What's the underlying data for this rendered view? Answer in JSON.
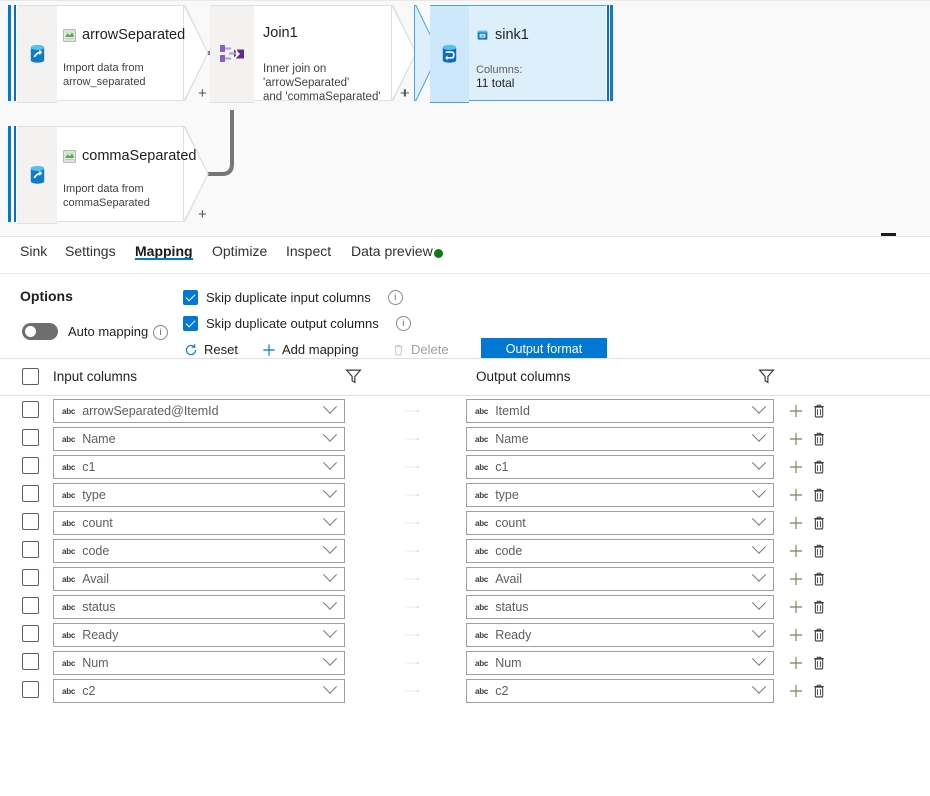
{
  "canvas": {
    "nodes": [
      {
        "id": "arrowSeparated",
        "title": "arrowSeparated",
        "subtitle": "Import data from\narrow_separated",
        "icon": "dataset-file-icon",
        "source_icon": "source-database-icon",
        "plus": "+"
      },
      {
        "id": "commaSeparated",
        "title": "commaSeparated",
        "subtitle": "Import data from\ncommaSeparated",
        "icon": "dataset-file-icon",
        "source_icon": "source-database-icon",
        "plus": "+"
      },
      {
        "id": "Join1",
        "title": "Join1",
        "subtitle": "Inner join on 'arrowSeparated'\nand 'commaSeparated'",
        "icon": "join-icon",
        "plus": "+"
      },
      {
        "id": "sink1",
        "title": "sink1",
        "subtitle_label": "Columns:",
        "subtitle_value": "11 total",
        "icon": "sink-dataset-icon",
        "sink_icon": "sink-database-icon",
        "selected": true
      }
    ],
    "minimize_label": "minimize-panel"
  },
  "tabs": {
    "items": [
      {
        "label": "Sink",
        "active": false
      },
      {
        "label": "Settings",
        "active": false
      },
      {
        "label": "Mapping",
        "active": true
      },
      {
        "label": "Optimize",
        "active": false
      },
      {
        "label": "Inspect",
        "active": false
      },
      {
        "label": "Data preview",
        "active": false,
        "status_dot": "#107c10"
      }
    ],
    "active_underline_color": "#0078d4"
  },
  "options": {
    "section_label": "Options",
    "checkboxes": [
      {
        "label": "Skip duplicate input columns",
        "checked": true,
        "info": "ⓘ"
      },
      {
        "label": "Skip duplicate output columns",
        "checked": true,
        "info": "ⓘ"
      }
    ],
    "auto_mapping": {
      "label": "Auto mapping",
      "on": false,
      "info": "ⓘ"
    },
    "commands": [
      {
        "label": "Reset",
        "icon": "refresh-icon",
        "disabled": false
      },
      {
        "label": "Add mapping",
        "icon": "plus-icon",
        "disabled": false
      },
      {
        "label": "Delete",
        "icon": "trash-icon",
        "disabled": true
      }
    ],
    "primary_button": {
      "label": "Output format",
      "color": "#0078d4"
    }
  },
  "table": {
    "headers": {
      "input": "Input columns",
      "output": "Output columns",
      "filter_icon": "filter-icon",
      "select_all_icon": "checkbox-unchecked"
    },
    "rows": [
      {
        "input": "arrowSeparated@ItemId",
        "output": "ItemId",
        "type": "abc"
      },
      {
        "input": "Name",
        "output": "Name",
        "type": "abc"
      },
      {
        "input": "c1",
        "output": "c1",
        "type": "abc"
      },
      {
        "input": "type",
        "output": "type",
        "type": "abc"
      },
      {
        "input": "count",
        "output": "count",
        "type": "abc"
      },
      {
        "input": "code",
        "output": "code",
        "type": "abc"
      },
      {
        "input": "Avail",
        "output": "Avail",
        "type": "abc"
      },
      {
        "input": "status",
        "output": "status",
        "type": "abc"
      },
      {
        "input": "Ready",
        "output": "Ready",
        "type": "abc"
      },
      {
        "input": "Num",
        "output": "Num",
        "type": "abc"
      },
      {
        "input": "c2",
        "output": "c2",
        "type": "abc"
      }
    ],
    "row_actions": {
      "add": "add-row-icon",
      "delete": "delete-row-icon"
    }
  }
}
